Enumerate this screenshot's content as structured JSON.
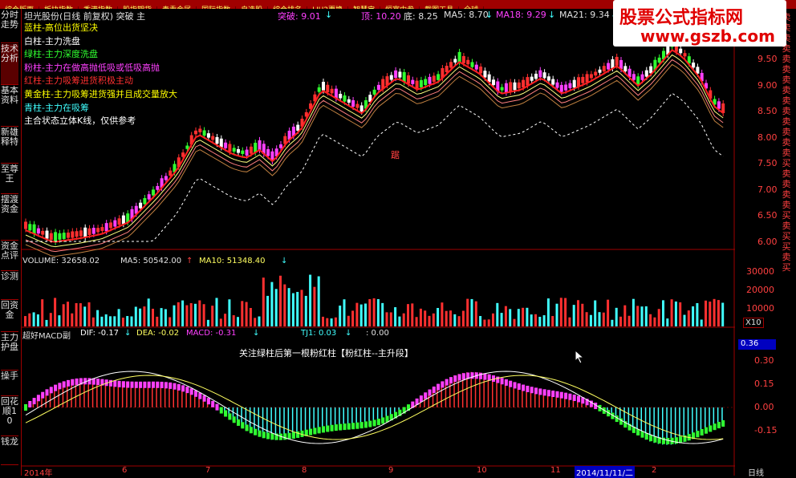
{
  "menu": [
    "综合版面",
    "板块指数",
    "香港指数",
    "股指期货",
    "贵重金属",
    "国际指数",
    "自选股",
    "综合排名",
    "LIU2更换",
    "智慧宝",
    "恒富内参",
    "截图工具",
    "全球"
  ],
  "left_tabs": [
    "分时走势",
    "技术分析",
    "基本资料",
    "新雄释特",
    "至尊王",
    "摆渡资金",
    "资金点评",
    "诊测",
    "回资金",
    "主力护盘",
    "操手",
    "回花顺10",
    "钱龙"
  ],
  "right_labels": [
    "卖",
    "卖",
    "卖",
    "卖",
    "卖",
    "卖",
    "卖",
    "卖",
    "卖",
    "卖",
    "卖",
    "卖",
    "卖",
    "卖",
    "买",
    "卖",
    "卖",
    "卖",
    "卖",
    "买",
    "卖",
    "买",
    "买",
    "卖",
    "买"
  ],
  "stock": {
    "title": "坦光股份(日线 前复权) 突破 主",
    "tupo": "突破: 9.01",
    "ding": "顶: 10.20",
    "di": "底: 8.25",
    "ma5": "MA5: 8.70",
    "ma18": "MA18: 9.29",
    "ma21": "MA21: 9.34"
  },
  "legend": [
    {
      "text": "蓝柱-高位出货坚决",
      "color": "#ffff00"
    },
    {
      "text": "白柱-主力洗盘",
      "color": "#ffffff"
    },
    {
      "text": "绿柱-主力深度洗盘",
      "color": "#30ff30"
    },
    {
      "text": "粉柱-主力在做高抛低吸或低吸高抛",
      "color": "#ff40ff"
    },
    {
      "text": "红柱-主力吸筹进货积极主动",
      "color": "#ff3030"
    },
    {
      "text": "黄金柱-主力吸筹进货强并且成交量放大",
      "color": "#ffff00"
    },
    {
      "text": "青柱-主力在吸筹",
      "color": "#40ffff"
    },
    {
      "text": "主合状态立体K线，仅供参考",
      "color": "#ffffff"
    }
  ],
  "price_axis": [
    "9.50",
    "9.00",
    "8.50",
    "8.00",
    "7.50",
    "7.00",
    "6.50",
    "6.00"
  ],
  "volume": {
    "label": "VOLUME: 32658.02",
    "ma5": "MA5: 50542.00",
    "ma10": "MA10: 51348.40",
    "axis": [
      "30000",
      "20000",
      "10000"
    ],
    "x_label": "X10"
  },
  "macd": {
    "name": "超好MACD副",
    "dif": "DIF: -0.17",
    "dea": "DEA: -0.02",
    "macd": "MACD: -0.31",
    "tj1": "TJ1: 0.03",
    "tail": ": 0.00",
    "note": "关注绿柱后第一根粉红柱【粉红柱--主升段】",
    "value_box": "0.36",
    "axis": [
      "0.30",
      "0.15",
      "0.00",
      "-0.15"
    ]
  },
  "dates": [
    "2014年",
    "6",
    "7",
    "8",
    "9",
    "10",
    "11",
    "2014/11/11/二",
    "2"
  ],
  "cursor_date": "2014/11/11/二",
  "period": "日线",
  "watermark": {
    "title": "股票公式指标网",
    "url": "www.gszb.com"
  },
  "markers": {
    "ju": "踞"
  },
  "colors": {
    "bg": "#000000",
    "up": "#ff3030",
    "down": "#30ff30",
    "pink": "#ff40ff",
    "cyan": "#40ffff",
    "axis": "#a00000"
  }
}
